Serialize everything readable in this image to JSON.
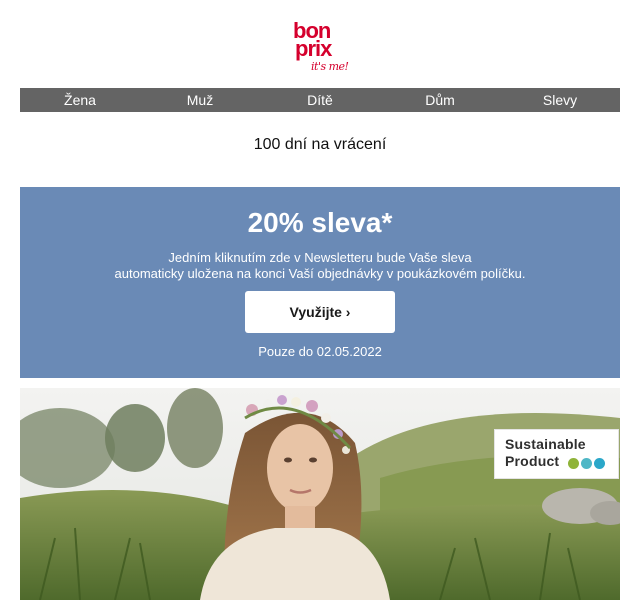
{
  "brand": {
    "line1": "bon",
    "line2": "prix",
    "tagline": "it's me!",
    "color": "#d5002d"
  },
  "nav": [
    {
      "label": "Žena"
    },
    {
      "label": "Muž"
    },
    {
      "label": "Dítě"
    },
    {
      "label": "Dům"
    },
    {
      "label": "Slevy"
    }
  ],
  "returns": {
    "text": "100 dní na vrácení"
  },
  "promo": {
    "headline": "20% sleva*",
    "desc_line1": "Jedním kliknutím zde v Newsletteru bude Vaše sleva",
    "desc_line2": "automaticky uložena na konci Vaší objednávky v poukázkovém políčku.",
    "cta": "Využijte ›",
    "valid": "Pouze do 02.05.2022",
    "background": "#6a8ab6"
  },
  "badge": {
    "line1": "Sustainable",
    "line2": "Product",
    "dot_colors": [
      "#8fb339",
      "#4fb7c6",
      "#2aa7c9"
    ]
  }
}
